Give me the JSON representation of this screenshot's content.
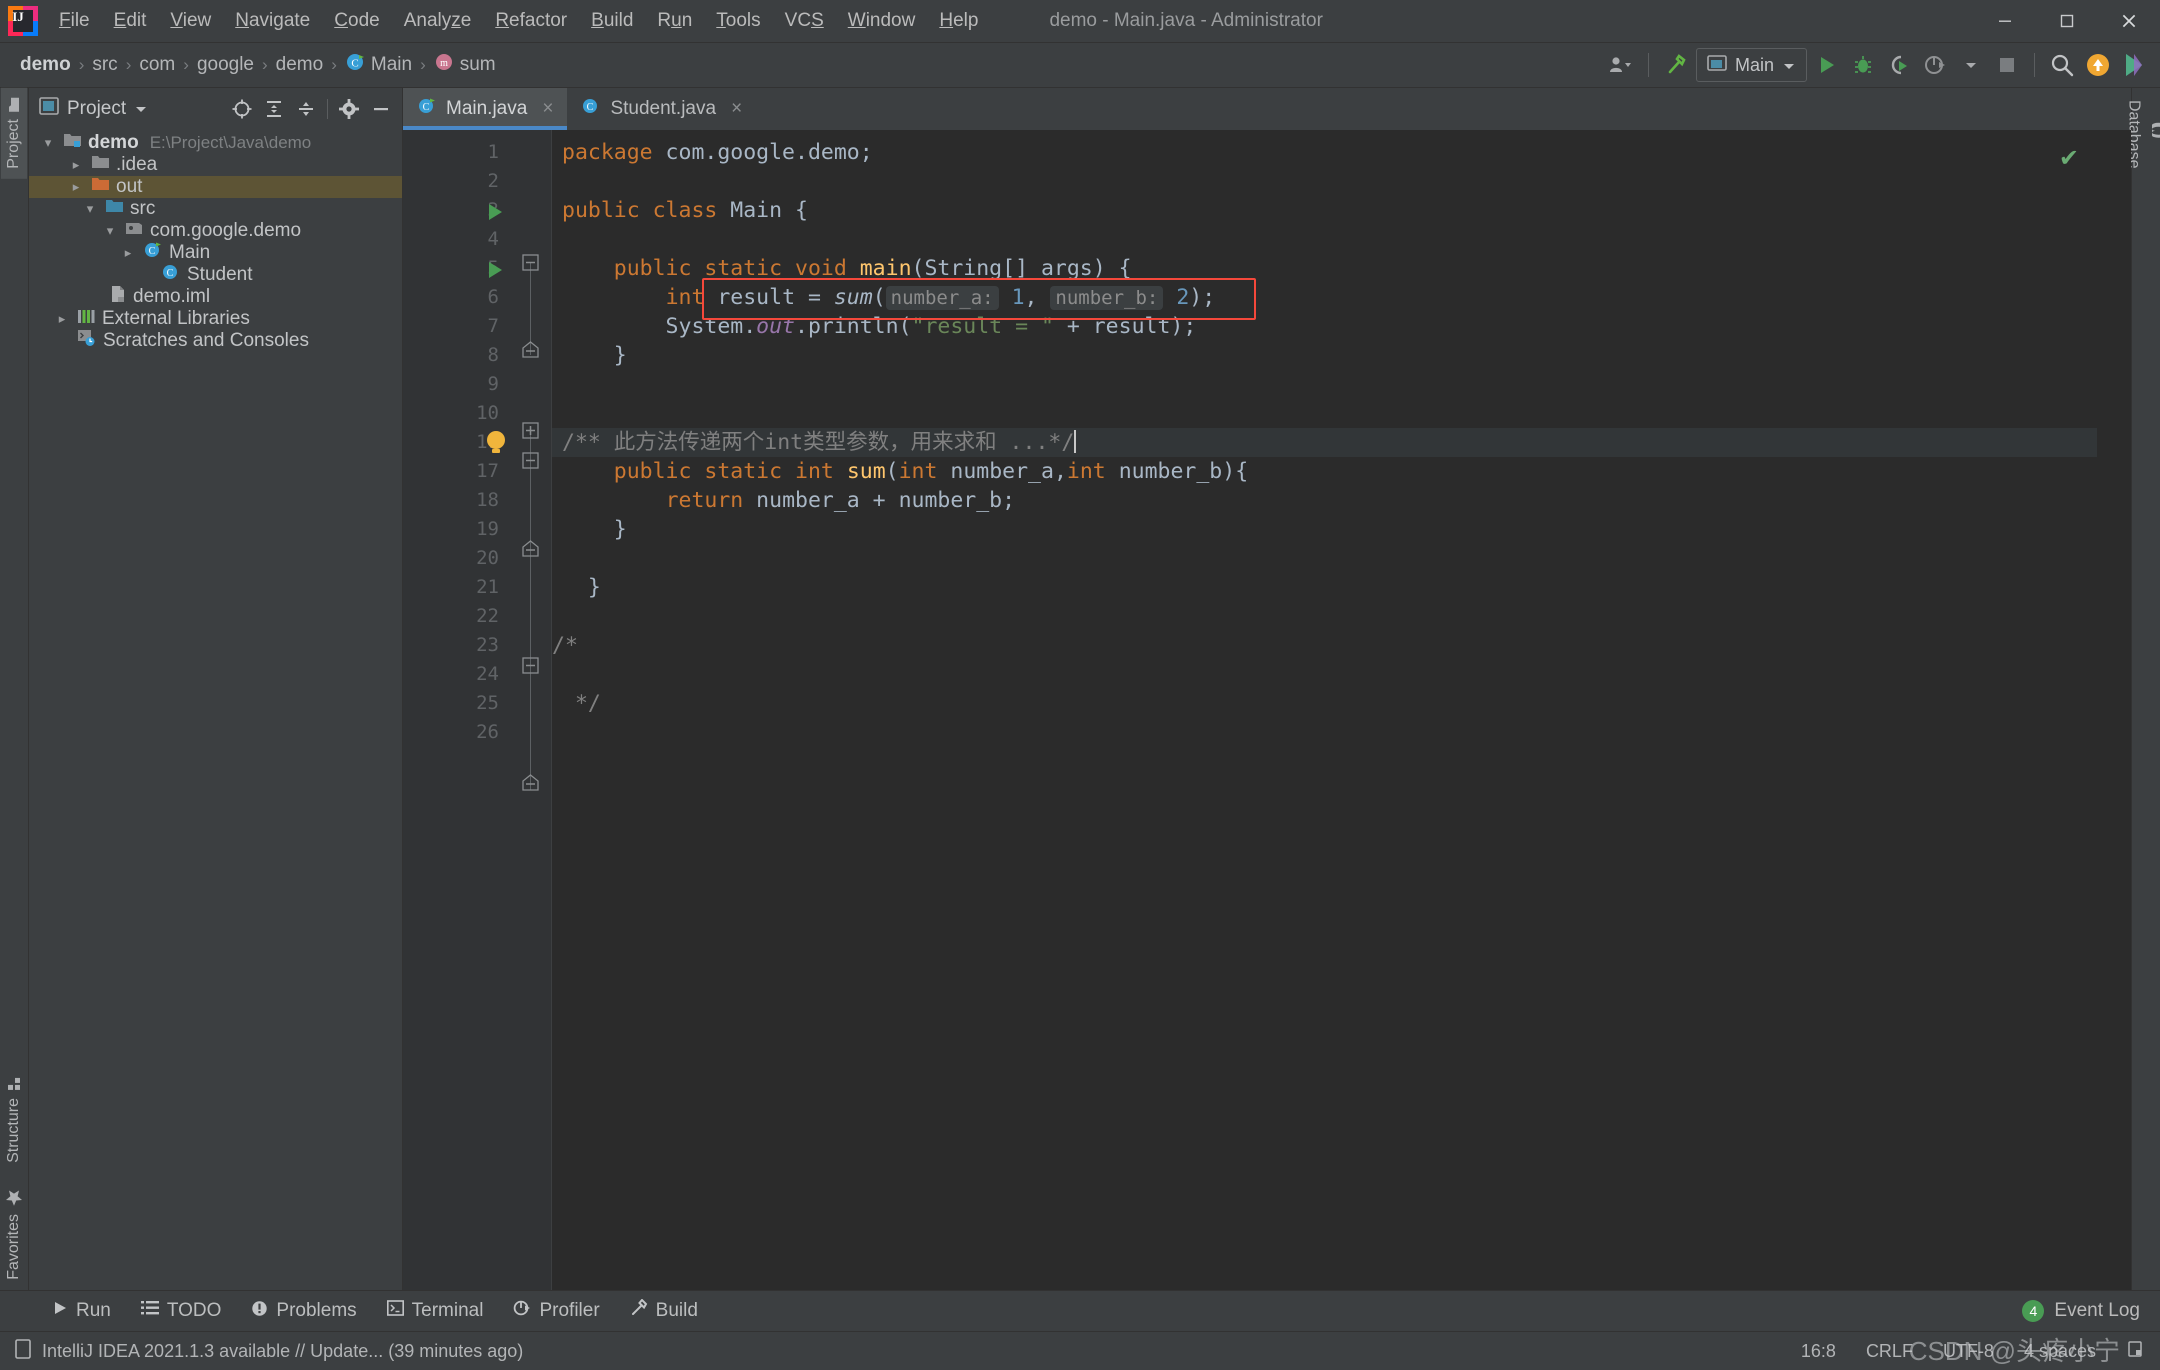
{
  "window": {
    "title": "demo - Main.java - Administrator",
    "minimize_label": "minimize-icon",
    "maximize_label": "maximize-icon",
    "close_label": "close-icon"
  },
  "menu": {
    "items": [
      "File",
      "Edit",
      "View",
      "Navigate",
      "Code",
      "Analyze",
      "Refactor",
      "Build",
      "Run",
      "Tools",
      "VCS",
      "Window",
      "Help"
    ]
  },
  "navbar": {
    "breadcrumbs": [
      {
        "label": "demo",
        "icon": "",
        "bold": true
      },
      {
        "label": "src",
        "icon": "",
        "bold": false
      },
      {
        "label": "com",
        "icon": "",
        "bold": false
      },
      {
        "label": "google",
        "icon": "",
        "bold": false
      },
      {
        "label": "demo",
        "icon": "",
        "bold": false
      },
      {
        "label": "Main",
        "icon": "class-icon",
        "bold": false
      },
      {
        "label": "sum",
        "icon": "method-icon",
        "bold": false
      }
    ],
    "separator": "›",
    "run_config": "Main",
    "buttons": [
      "user-icon",
      "build-hammer-icon",
      "run-config-select",
      "run-icon",
      "debug-icon",
      "run-with-coverage-icon",
      "profiler-icon",
      "stop-icon",
      "search-everywhere-icon",
      "update-icon",
      "ide-color-icon"
    ]
  },
  "left_stripe": {
    "top": [
      {
        "label": "Project",
        "icon": "project-folder-icon",
        "selected": true
      }
    ],
    "bottom": [
      {
        "label": "Structure",
        "icon": "structure-icon",
        "selected": false
      },
      {
        "label": "Favorites",
        "icon": "star-icon",
        "selected": false
      }
    ]
  },
  "right_stripe": {
    "items": [
      {
        "label": "Database",
        "icon": "database-icon",
        "selected": false
      }
    ]
  },
  "project_panel": {
    "title": "Project",
    "tool_buttons": [
      "locate-icon",
      "expand-all-icon",
      "collapse-all-icon",
      "settings-gear-icon",
      "hide-icon"
    ],
    "tree": [
      {
        "label": "demo",
        "path": "E:\\Project\\Java\\demo",
        "icon": "module-folder-icon",
        "indent": 0,
        "arrow": "down",
        "bold": true,
        "selected": false
      },
      {
        "label": ".idea",
        "path": "",
        "icon": "folder-icon",
        "indent": 1,
        "arrow": "right",
        "bold": false,
        "selected": false
      },
      {
        "label": "out",
        "path": "",
        "icon": "folder-excluded-icon",
        "indent": 1,
        "arrow": "right",
        "bold": false,
        "selected": true
      },
      {
        "label": "src",
        "path": "",
        "icon": "source-folder-icon",
        "indent": 1,
        "arrow": "down",
        "bold": false,
        "selected": false
      },
      {
        "label": "com.google.demo",
        "path": "",
        "icon": "package-icon",
        "indent": 2,
        "arrow": "down",
        "bold": false,
        "selected": false
      },
      {
        "label": "Main",
        "path": "",
        "icon": "runnable-class-icon",
        "indent": 3,
        "arrow": "right",
        "bold": false,
        "selected": false
      },
      {
        "label": "Student",
        "path": "",
        "icon": "class-icon",
        "indent": 4,
        "arrow": "none",
        "bold": false,
        "selected": false
      },
      {
        "label": "demo.iml",
        "path": "",
        "icon": "iml-file-icon",
        "indent": 2,
        "arrow": "none",
        "bold": false,
        "selected": false
      },
      {
        "label": "External Libraries",
        "path": "",
        "icon": "libraries-icon",
        "indent": 0,
        "arrow": "right",
        "bold": false,
        "selected": false
      },
      {
        "label": "Scratches and Consoles",
        "path": "",
        "icon": "scratches-icon",
        "indent": 0,
        "arrow": "none",
        "bold": false,
        "selected": false
      }
    ]
  },
  "editor": {
    "tabs": [
      {
        "label": "Main.java",
        "icon": "runnable-class-icon",
        "active": true,
        "close": "×"
      },
      {
        "label": "Student.java",
        "icon": "class-icon",
        "active": false,
        "close": "×"
      }
    ],
    "inspection_ok": "✔",
    "lines": [
      {
        "num": "1",
        "runmark": false,
        "fold": "",
        "bulb": false,
        "folded": false
      },
      {
        "num": "2",
        "runmark": false,
        "fold": "",
        "bulb": false,
        "folded": false
      },
      {
        "num": "3",
        "runmark": true,
        "fold": "",
        "bulb": false,
        "folded": false
      },
      {
        "num": "4",
        "runmark": false,
        "fold": "",
        "bulb": false,
        "folded": false
      },
      {
        "num": "5",
        "runmark": true,
        "fold": "open",
        "bulb": false,
        "folded": false
      },
      {
        "num": "6",
        "runmark": false,
        "fold": "",
        "bulb": false,
        "folded": false
      },
      {
        "num": "7",
        "runmark": false,
        "fold": "",
        "bulb": false,
        "folded": false
      },
      {
        "num": "8",
        "runmark": false,
        "fold": "end",
        "bulb": false,
        "folded": false
      },
      {
        "num": "9",
        "runmark": false,
        "fold": "",
        "bulb": false,
        "folded": false
      },
      {
        "num": "10",
        "runmark": false,
        "fold": "",
        "bulb": false,
        "folded": false
      },
      {
        "num": "11",
        "runmark": false,
        "fold": "closed",
        "bulb": true,
        "folded": true
      },
      {
        "num": "17",
        "runmark": false,
        "fold": "open",
        "bulb": false,
        "folded": false
      },
      {
        "num": "18",
        "runmark": false,
        "fold": "",
        "bulb": false,
        "folded": false
      },
      {
        "num": "19",
        "runmark": false,
        "fold": "end",
        "bulb": false,
        "folded": false
      },
      {
        "num": "20",
        "runmark": false,
        "fold": "",
        "bulb": false,
        "folded": false
      },
      {
        "num": "21",
        "runmark": false,
        "fold": "",
        "bulb": false,
        "folded": false
      },
      {
        "num": "22",
        "runmark": false,
        "fold": "",
        "bulb": false,
        "folded": false
      },
      {
        "num": "23",
        "runmark": false,
        "fold": "open",
        "bulb": false,
        "folded": false
      },
      {
        "num": "24",
        "runmark": false,
        "fold": "",
        "bulb": false,
        "folded": false
      },
      {
        "num": "25",
        "runmark": false,
        "fold": "end",
        "bulb": false,
        "folded": false
      },
      {
        "num": "26",
        "runmark": false,
        "fold": "",
        "bulb": false,
        "folded": false
      }
    ],
    "code_text": [
      "package com.google.demo;",
      "",
      "public class Main {",
      "",
      "    public static void main(String[] args) {",
      "        int result = sum( number_a: 1, number_b: 2);",
      "        System.out.println(\"result = \" + result);",
      "    }",
      "",
      "",
      "    /** 此方法传递两个int类型参数，用来求和 ...*/",
      "    public static int sum(int number_a,int number_b){",
      "        return number_a + number_b;",
      "    }",
      "",
      "  }",
      "",
      "/*",
      "",
      " */",
      ""
    ],
    "highlighted_line": "int result = sum( number_a: 1, number_b: 2);",
    "highlight_color": "#f5483b",
    "folded_comment": "/** 此方法传递两个int类型参数，用来求和 ...*/"
  },
  "bottom_bar": {
    "items": [
      {
        "label": "Run",
        "icon": "run-icon"
      },
      {
        "label": "TODO",
        "icon": "todo-icon"
      },
      {
        "label": "Problems",
        "icon": "problems-icon"
      },
      {
        "label": "Terminal",
        "icon": "terminal-icon"
      },
      {
        "label": "Profiler",
        "icon": "profiler-icon"
      },
      {
        "label": "Build",
        "icon": "build-hammer-icon"
      }
    ],
    "event_log_label": "Event Log",
    "event_log_count": "4"
  },
  "status_bar": {
    "message": "IntelliJ IDEA 2021.1.3 available // Update... (39 minutes ago)",
    "caret_position": "16:8",
    "line_separator": "CRLF",
    "encoding": "UTF-8",
    "indent": "4 spaces",
    "watermark": "CSDN @头疼小宁"
  }
}
